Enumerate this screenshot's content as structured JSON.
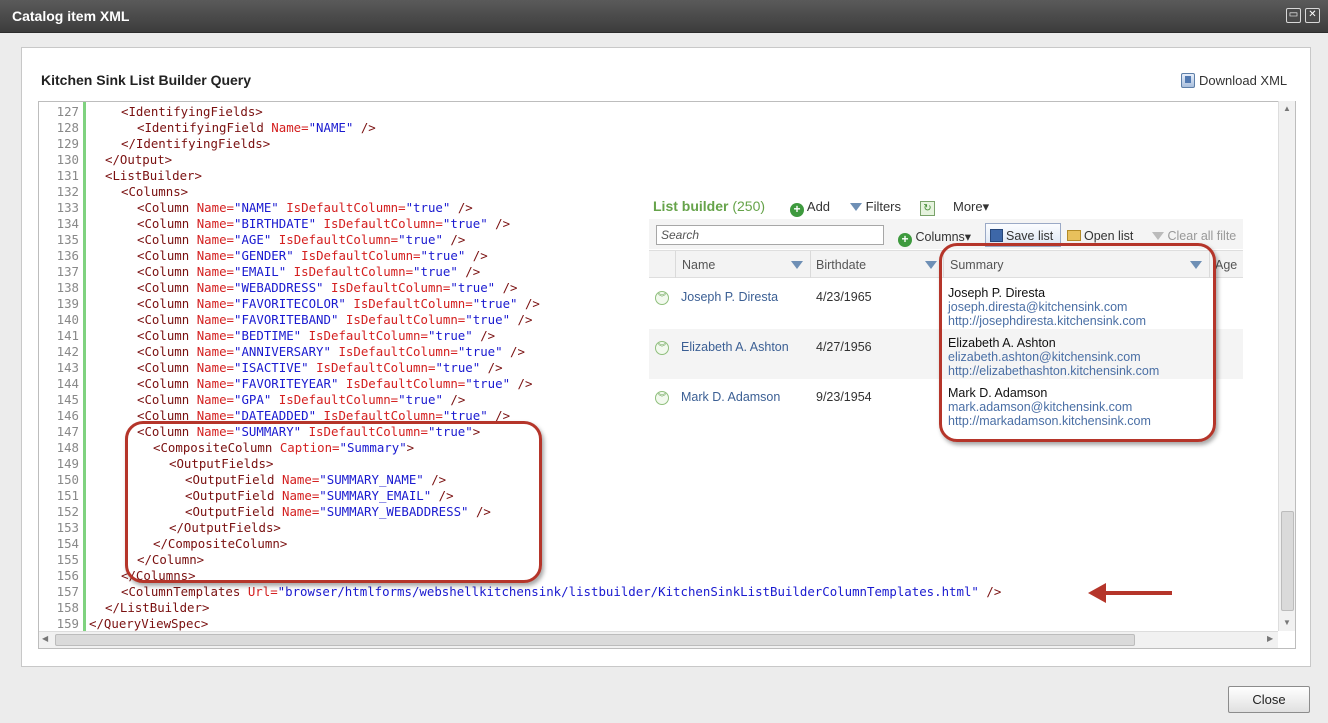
{
  "window": {
    "title": "Catalog item XML",
    "max_icon": "maximize-icon",
    "close_icon": "close-icon"
  },
  "heading": "Kitchen Sink List Builder Query",
  "download_label": "Download XML",
  "code": {
    "lines": [
      {
        "n": "127",
        "indent": 4,
        "parts": [
          [
            "t",
            "<IdentifyingFields>"
          ]
        ]
      },
      {
        "n": "128",
        "indent": 6,
        "parts": [
          [
            "t",
            "<IdentifyingField "
          ],
          [
            "a",
            "Name="
          ],
          [
            "v",
            "\"NAME\""
          ],
          [
            "t",
            " />"
          ]
        ]
      },
      {
        "n": "129",
        "indent": 4,
        "parts": [
          [
            "t",
            "</IdentifyingFields>"
          ]
        ]
      },
      {
        "n": "130",
        "indent": 2,
        "parts": [
          [
            "t",
            "</Output>"
          ]
        ]
      },
      {
        "n": "131",
        "indent": 2,
        "parts": [
          [
            "t",
            "<ListBuilder>"
          ]
        ]
      },
      {
        "n": "132",
        "indent": 4,
        "parts": [
          [
            "t",
            "<Columns>"
          ]
        ]
      },
      {
        "n": "133",
        "indent": 6,
        "parts": [
          [
            "t",
            "<Column "
          ],
          [
            "a",
            "Name="
          ],
          [
            "v",
            "\"NAME\""
          ],
          [
            "a",
            " IsDefaultColumn="
          ],
          [
            "v",
            "\"true\""
          ],
          [
            "t",
            " />"
          ]
        ]
      },
      {
        "n": "134",
        "indent": 6,
        "parts": [
          [
            "t",
            "<Column "
          ],
          [
            "a",
            "Name="
          ],
          [
            "v",
            "\"BIRTHDATE\""
          ],
          [
            "a",
            " IsDefaultColumn="
          ],
          [
            "v",
            "\"true\""
          ],
          [
            "t",
            " />"
          ]
        ]
      },
      {
        "n": "135",
        "indent": 6,
        "parts": [
          [
            "t",
            "<Column "
          ],
          [
            "a",
            "Name="
          ],
          [
            "v",
            "\"AGE\""
          ],
          [
            "a",
            " IsDefaultColumn="
          ],
          [
            "v",
            "\"true\""
          ],
          [
            "t",
            " />"
          ]
        ]
      },
      {
        "n": "136",
        "indent": 6,
        "parts": [
          [
            "t",
            "<Column "
          ],
          [
            "a",
            "Name="
          ],
          [
            "v",
            "\"GENDER\""
          ],
          [
            "a",
            " IsDefaultColumn="
          ],
          [
            "v",
            "\"true\""
          ],
          [
            "t",
            " />"
          ]
        ]
      },
      {
        "n": "137",
        "indent": 6,
        "parts": [
          [
            "t",
            "<Column "
          ],
          [
            "a",
            "Name="
          ],
          [
            "v",
            "\"EMAIL\""
          ],
          [
            "a",
            " IsDefaultColumn="
          ],
          [
            "v",
            "\"true\""
          ],
          [
            "t",
            " />"
          ]
        ]
      },
      {
        "n": "138",
        "indent": 6,
        "parts": [
          [
            "t",
            "<Column "
          ],
          [
            "a",
            "Name="
          ],
          [
            "v",
            "\"WEBADDRESS\""
          ],
          [
            "a",
            " IsDefaultColumn="
          ],
          [
            "v",
            "\"true\""
          ],
          [
            "t",
            " />"
          ]
        ]
      },
      {
        "n": "139",
        "indent": 6,
        "parts": [
          [
            "t",
            "<Column "
          ],
          [
            "a",
            "Name="
          ],
          [
            "v",
            "\"FAVORITECOLOR\""
          ],
          [
            "a",
            " IsDefaultColumn="
          ],
          [
            "v",
            "\"true\""
          ],
          [
            "t",
            " />"
          ]
        ]
      },
      {
        "n": "140",
        "indent": 6,
        "parts": [
          [
            "t",
            "<Column "
          ],
          [
            "a",
            "Name="
          ],
          [
            "v",
            "\"FAVORITEBAND\""
          ],
          [
            "a",
            " IsDefaultColumn="
          ],
          [
            "v",
            "\"true\""
          ],
          [
            "t",
            " />"
          ]
        ]
      },
      {
        "n": "141",
        "indent": 6,
        "parts": [
          [
            "t",
            "<Column "
          ],
          [
            "a",
            "Name="
          ],
          [
            "v",
            "\"BEDTIME\""
          ],
          [
            "a",
            " IsDefaultColumn="
          ],
          [
            "v",
            "\"true\""
          ],
          [
            "t",
            " />"
          ]
        ]
      },
      {
        "n": "142",
        "indent": 6,
        "parts": [
          [
            "t",
            "<Column "
          ],
          [
            "a",
            "Name="
          ],
          [
            "v",
            "\"ANNIVERSARY\""
          ],
          [
            "a",
            " IsDefaultColumn="
          ],
          [
            "v",
            "\"true\""
          ],
          [
            "t",
            " />"
          ]
        ]
      },
      {
        "n": "143",
        "indent": 6,
        "parts": [
          [
            "t",
            "<Column "
          ],
          [
            "a",
            "Name="
          ],
          [
            "v",
            "\"ISACTIVE\""
          ],
          [
            "a",
            " IsDefaultColumn="
          ],
          [
            "v",
            "\"true\""
          ],
          [
            "t",
            " />"
          ]
        ]
      },
      {
        "n": "144",
        "indent": 6,
        "parts": [
          [
            "t",
            "<Column "
          ],
          [
            "a",
            "Name="
          ],
          [
            "v",
            "\"FAVORITEYEAR\""
          ],
          [
            "a",
            " IsDefaultColumn="
          ],
          [
            "v",
            "\"true\""
          ],
          [
            "t",
            " />"
          ]
        ]
      },
      {
        "n": "145",
        "indent": 6,
        "parts": [
          [
            "t",
            "<Column "
          ],
          [
            "a",
            "Name="
          ],
          [
            "v",
            "\"GPA\""
          ],
          [
            "a",
            " IsDefaultColumn="
          ],
          [
            "v",
            "\"true\""
          ],
          [
            "t",
            " />"
          ]
        ]
      },
      {
        "n": "146",
        "indent": 6,
        "parts": [
          [
            "t",
            "<Column "
          ],
          [
            "a",
            "Name="
          ],
          [
            "v",
            "\"DATEADDED\""
          ],
          [
            "a",
            " IsDefaultColumn="
          ],
          [
            "v",
            "\"true\""
          ],
          [
            "t",
            " />"
          ]
        ]
      },
      {
        "n": "147",
        "indent": 6,
        "parts": [
          [
            "t",
            "<Column "
          ],
          [
            "a",
            "Name="
          ],
          [
            "v",
            "\"SUMMARY\""
          ],
          [
            "a",
            " IsDefaultColumn="
          ],
          [
            "v",
            "\"true\""
          ],
          [
            "t",
            ">"
          ]
        ]
      },
      {
        "n": "148",
        "indent": 8,
        "parts": [
          [
            "t",
            "<CompositeColumn "
          ],
          [
            "a",
            "Caption="
          ],
          [
            "v",
            "\"Summary\""
          ],
          [
            "t",
            ">"
          ]
        ]
      },
      {
        "n": "149",
        "indent": 10,
        "parts": [
          [
            "t",
            "<OutputFields>"
          ]
        ]
      },
      {
        "n": "150",
        "indent": 12,
        "parts": [
          [
            "t",
            "<OutputField "
          ],
          [
            "a",
            "Name="
          ],
          [
            "v",
            "\"SUMMARY_NAME\""
          ],
          [
            "t",
            " />"
          ]
        ]
      },
      {
        "n": "151",
        "indent": 12,
        "parts": [
          [
            "t",
            "<OutputField "
          ],
          [
            "a",
            "Name="
          ],
          [
            "v",
            "\"SUMMARY_EMAIL\""
          ],
          [
            "t",
            " />"
          ]
        ]
      },
      {
        "n": "152",
        "indent": 12,
        "parts": [
          [
            "t",
            "<OutputField "
          ],
          [
            "a",
            "Name="
          ],
          [
            "v",
            "\"SUMMARY_WEBADDRESS\""
          ],
          [
            "t",
            " />"
          ]
        ]
      },
      {
        "n": "153",
        "indent": 10,
        "parts": [
          [
            "t",
            "</OutputFields>"
          ]
        ]
      },
      {
        "n": "154",
        "indent": 8,
        "parts": [
          [
            "t",
            "</CompositeColumn>"
          ]
        ]
      },
      {
        "n": "155",
        "indent": 6,
        "parts": [
          [
            "t",
            "</Column>"
          ]
        ]
      },
      {
        "n": "156",
        "indent": 4,
        "parts": [
          [
            "t",
            "</Columns>"
          ]
        ]
      },
      {
        "n": "157",
        "indent": 4,
        "parts": [
          [
            "t",
            "<ColumnTemplates "
          ],
          [
            "a",
            "Url="
          ],
          [
            "v",
            "\"browser/htmlforms/webshellkitchensink/listbuilder/KitchenSinkListBuilderColumnTemplates.html\""
          ],
          [
            "t",
            " />"
          ]
        ]
      },
      {
        "n": "158",
        "indent": 2,
        "parts": [
          [
            "t",
            "</ListBuilder>"
          ]
        ]
      },
      {
        "n": "159",
        "indent": 0,
        "parts": [
          [
            "t",
            "</QueryViewSpec>"
          ]
        ]
      }
    ]
  },
  "list_builder": {
    "title": "List builder",
    "count": "(250)",
    "add": "Add",
    "filters": "Filters",
    "more": "More▾",
    "search_placeholder": "Search",
    "columns": "Columns▾",
    "save_list": "Save list",
    "open_list": "Open list",
    "clear_filters": "Clear all filte",
    "headers": {
      "name": "Name",
      "birthdate": "Birthdate",
      "summary": "Summary",
      "age": "Age"
    },
    "rows": [
      {
        "name": "Joseph P. Diresta",
        "birthdate": "4/23/1965",
        "s_name": "Joseph P. Diresta",
        "s_email": "joseph.diresta@kitchensink.com",
        "s_web": "http://josephdiresta.kitchensink.com"
      },
      {
        "name": "Elizabeth A. Ashton",
        "birthdate": "4/27/1956",
        "s_name": "Elizabeth A. Ashton",
        "s_email": "elizabeth.ashton@kitchensink.com",
        "s_web": "http://elizabethashton.kitchensink.com"
      },
      {
        "name": "Mark D. Adamson",
        "birthdate": "9/23/1954",
        "s_name": "Mark D. Adamson",
        "s_email": "mark.adamson@kitchensink.com",
        "s_web": "http://markadamson.kitchensink.com"
      }
    ]
  },
  "close_label": "Close",
  "colors": {
    "highlight": "#b5352a",
    "lb_green": "#66a34a",
    "link_blue": "#3b5f94"
  }
}
